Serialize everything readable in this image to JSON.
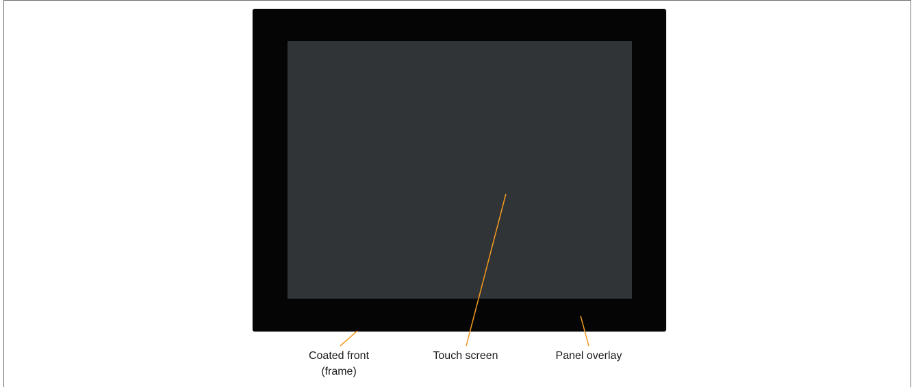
{
  "labels": {
    "coated_front_line1": "Coated front",
    "coated_front_line2": "(frame)",
    "touch_screen": "Touch screen",
    "panel_overlay": "Panel overlay"
  },
  "colors": {
    "leader_line": "#f39a1e",
    "panel_frame": "#050505",
    "display_area": "#313437"
  }
}
